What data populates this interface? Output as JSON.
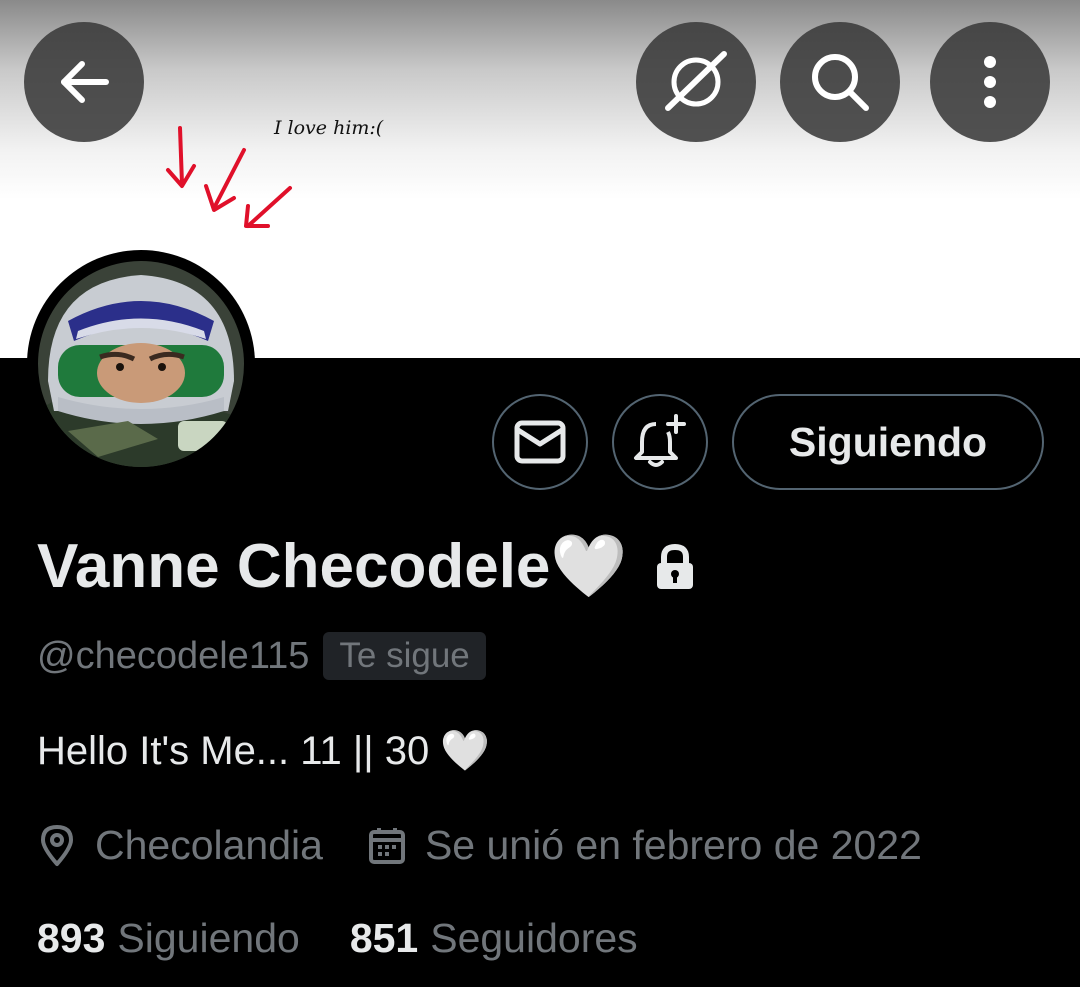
{
  "banner": {
    "note": "I love him:("
  },
  "topbar": {
    "icons": [
      "back-arrow-icon",
      "grok-icon",
      "search-icon",
      "more-vertical-icon"
    ]
  },
  "profile": {
    "name": "Vanne Checodele🤍",
    "handle": "@checodele115",
    "follows_you": "Te sigue",
    "bio": "Hello It's Me...  11 || 30 🤍",
    "location": "Checolandia",
    "joined": "Se unió en febrero de 2022",
    "following_count": "893",
    "following_label": "Siguiendo",
    "followers_count": "851",
    "followers_label": "Seguidores"
  },
  "actions": {
    "follow_button": "Siguiendo"
  },
  "colors": {
    "background": "#000000",
    "text_primary": "#e7e9ea",
    "text_secondary": "#71767b",
    "border": "#536471",
    "arrow_red": "#e0102a"
  }
}
